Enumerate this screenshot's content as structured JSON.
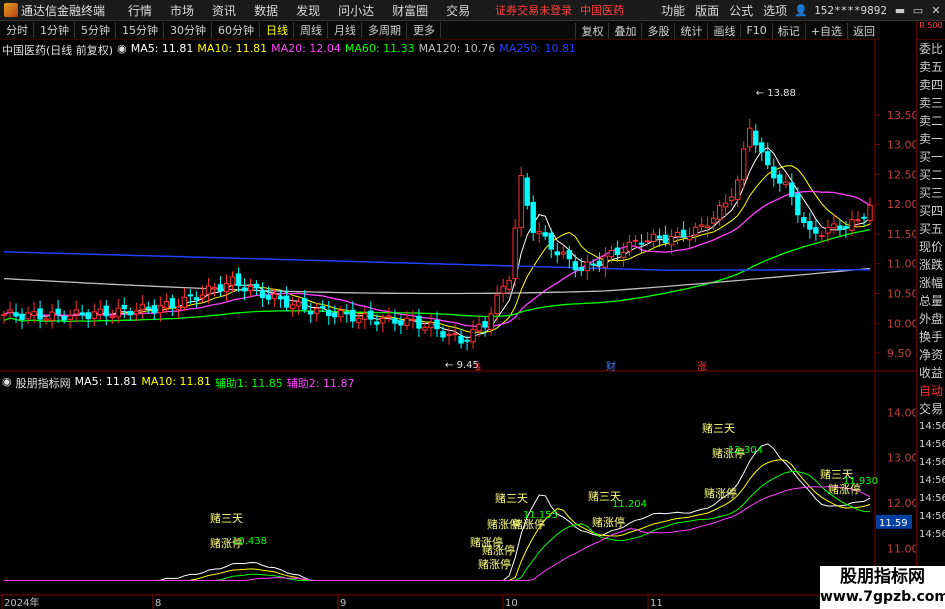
{
  "menubar": {
    "app_title": "通达信金融终端",
    "items": [
      "行情",
      "市场",
      "资讯",
      "数据",
      "发现",
      "问小达",
      "财富圈",
      "交易"
    ],
    "warning": "证券交易未登录",
    "stock_name": "中国医药",
    "right_items": [
      "功能",
      "版面",
      "公式",
      "选项"
    ],
    "user": "152****9892",
    "win_buttons": [
      "▬",
      "▭",
      "✕"
    ]
  },
  "toolbar": {
    "periods": [
      "分时",
      "1分钟",
      "5分钟",
      "15分钟",
      "30分钟",
      "60分钟",
      "日线",
      "周线",
      "月线",
      "多周期",
      "更多"
    ],
    "active_period": "日线",
    "right_buttons": [
      "复权",
      "叠加",
      "多股",
      "统计",
      "画线",
      "F10",
      "标记",
      "+自选",
      "返回"
    ]
  },
  "main_legend": {
    "title": "中国医药(日线 前复权)",
    "ma5": "MA5: 11.81",
    "ma10": "MA10: 11.81",
    "ma20": "MA20: 12.04",
    "ma60": "MA60: 11.33",
    "ma120": "MA120: 10.76",
    "ma250": "MA250: 10.81"
  },
  "sub_legend": {
    "title": "股朋指标网",
    "ma5": "MA5: 11.81",
    "ma10": "MA10: 11.81",
    "aux1": "辅助1: 11.85",
    "aux2": "辅助2: 11.87"
  },
  "side_panel": {
    "top": "R 500",
    "items": [
      "委比",
      "卖五",
      "卖四",
      "卖三",
      "卖二",
      "卖一",
      "买一",
      "买二",
      "买三",
      "买四",
      "买五",
      "现价",
      "涨跌",
      "涨幅",
      "总量",
      "外盘",
      "换手",
      "净资",
      "收益"
    ],
    "bottom_red": "自动",
    "bottom2": "交易",
    "times": [
      "14:56",
      "14:56",
      "14:56",
      "14:56",
      "14:56",
      "14:56",
      "14:56",
      "14:56",
      "14:56"
    ]
  },
  "chart_data": [
    {
      "type": "candlestick",
      "title": "中国医药(日线 前复权)",
      "y_ticks": [
        "13.50",
        "13.00",
        "12.50",
        "12.00",
        "11.50",
        "11.00",
        "10.50",
        "10.00",
        "9.50"
      ],
      "ylim": [
        9.3,
        14.0
      ],
      "high_label": "13.88",
      "low_label": "9.45",
      "x_labels": [
        "2024年",
        "8",
        "9",
        "10",
        "11",
        "1"
      ],
      "event_markers": [
        {
          "label": "$",
          "color": "#ff3030"
        },
        {
          "label": "财",
          "color": "#4080ff"
        },
        {
          "label": "涨",
          "color": "#ff3030"
        }
      ],
      "colors": {
        "up": "#ff3030",
        "down": "#00ffff",
        "ma5": "#ffffff",
        "ma10": "#ffff00",
        "ma20": "#ff40ff",
        "ma60": "#00ff00",
        "ma120": "#c0c0c0",
        "ma250": "#2040ff"
      }
    },
    {
      "type": "line",
      "title": "股朋指标网",
      "y_ticks": [
        "14.00",
        "13.00",
        "12.00",
        "11.00"
      ],
      "current_value": "11.59",
      "annotations": [
        "赌三天",
        "赌涨停",
        "赌三天",
        "赌涨停",
        "赌涨停",
        "赌涨停",
        "赌涨停",
        "赌三天",
        "赌涨停",
        "赌三天",
        "赌涨停",
        "赌三天",
        "赌涨停",
        "赌涨停",
        "赌涨停"
      ],
      "value_labels": [
        "10.438",
        "11.155",
        "11.204",
        "12.304",
        "11.930"
      ]
    }
  ],
  "watermark": {
    "line1": "股朋指标网",
    "line2": "www.7gpzb.com"
  }
}
